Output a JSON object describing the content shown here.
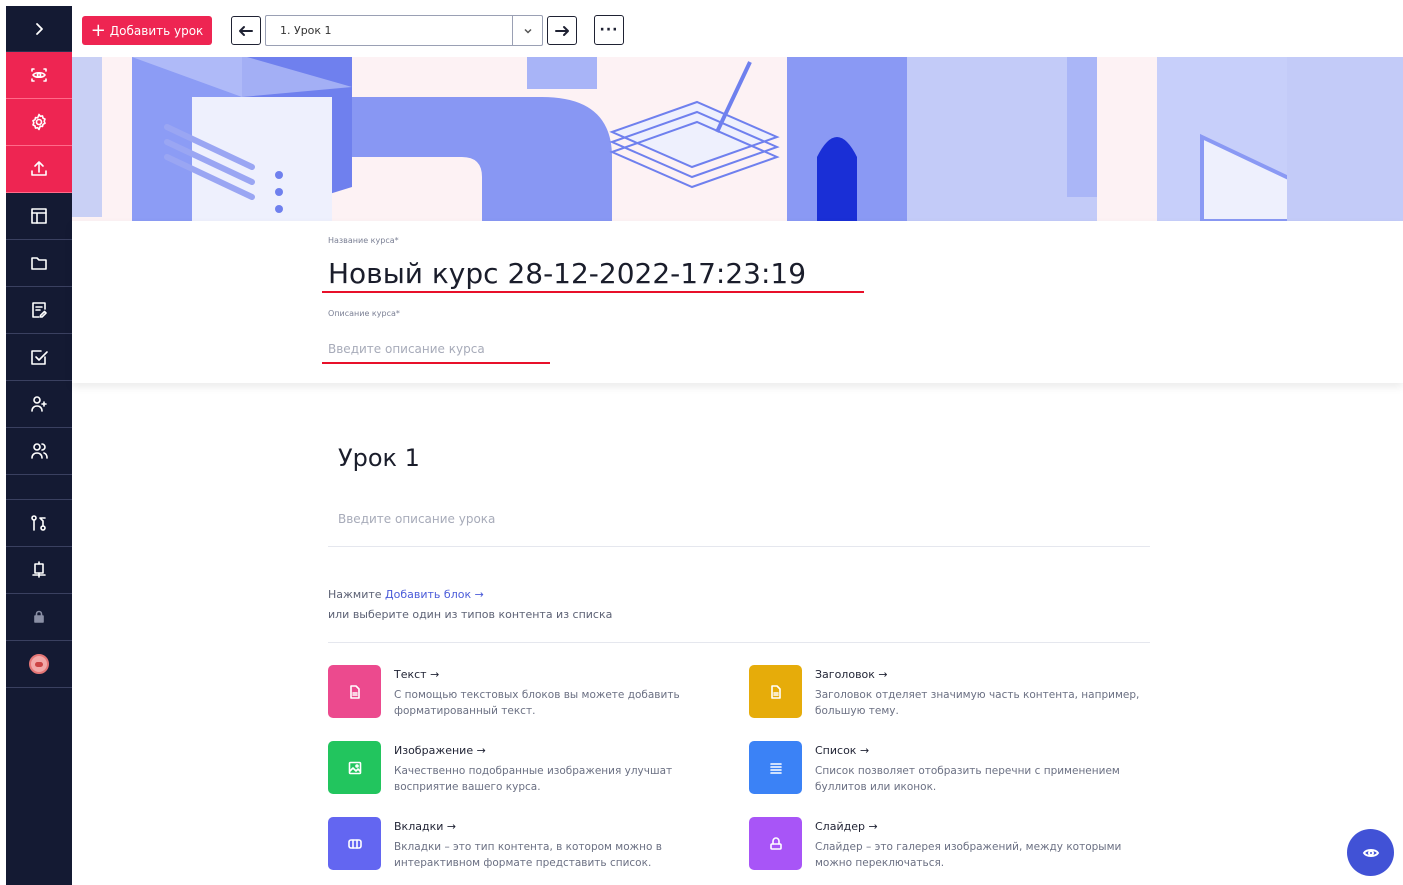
{
  "toolbar": {
    "add_lesson_label": "Добавить урок",
    "lesson_select_value": "1. Урок 1",
    "more_label": "···"
  },
  "rail": {
    "icons": [
      "chevron-right-icon",
      "eye-icon",
      "gear-icon",
      "upload-icon",
      "layout-icon",
      "folder-icon",
      "edit-note-icon",
      "checkbox-icon",
      "add-user-icon",
      "users-icon",
      "branch-icon",
      "certificate-icon",
      "lock-icon",
      "avatar"
    ]
  },
  "course": {
    "title_label": "Название курса*",
    "title": "Новый курс 28-12-2022-17:23:19",
    "desc_label": "Описание курса*",
    "desc_placeholder": "Введите описание курса"
  },
  "lesson": {
    "title": "Урок 1",
    "desc_placeholder": "Введите описание урока",
    "hint_prefix": "Нажмите ",
    "hint_link": "Добавить блок →",
    "hint_line2": "или выберите один из типов контента из списка"
  },
  "blocks": [
    {
      "title": "Текст →",
      "desc": "С помощью текстовых блоков вы можете добавить форматированный текст.",
      "color": "#ec4a8e",
      "icon": "document-icon"
    },
    {
      "title": "Заголовок →",
      "desc": "Заголовок отделяет значимую часть контента, например, большую тему.",
      "color": "#e6ac0a",
      "icon": "document-icon"
    },
    {
      "title": "Изображение →",
      "desc": "Качественно подобранные изображения улучшат восприятие вашего курса.",
      "color": "#22c55e",
      "icon": "image-icon"
    },
    {
      "title": "Список →",
      "desc": "Список позволяет отобразить перечни с применением буллитов или иконок.",
      "color": "#3b82f6",
      "icon": "list-icon"
    },
    {
      "title": "Вкладки →",
      "desc": "Вкладки – это тип контента, в котором можно в интерактивном формате представить список.",
      "color": "#6366f1",
      "icon": "columns-icon"
    },
    {
      "title": "Слайдер →",
      "desc": "Слайдер – это галерея изображений, между которыми можно переключаться.",
      "color": "#a855f7",
      "icon": "slider-icon"
    }
  ],
  "colors": {
    "accent": "#ee2552",
    "rail_bg": "#141a33",
    "fab": "#4152d6"
  }
}
